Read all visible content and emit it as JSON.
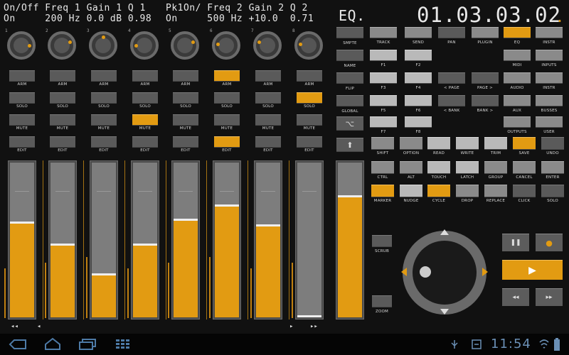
{
  "header": {
    "line1a": "On/Off Freq 1 Gain 1 Q 1",
    "line2a": "On     200 Hz 0.0 dB 0.98",
    "line1b": "Pk1On/ Freq 2 Gain 2 Q 2",
    "line2b": "On     500 Hz +10.0  0.71",
    "mode": "EQ.",
    "timecode": "01.03.03.02",
    "timecode_dot": "."
  },
  "knobs": [
    {
      "id": "1",
      "level": 0.85
    },
    {
      "id": "2",
      "level": 0.75
    },
    {
      "id": "3",
      "level": 0.5
    },
    {
      "id": "4",
      "level": 0.15
    },
    {
      "id": "5",
      "level": 0.75
    },
    {
      "id": "6",
      "level": 0.2
    },
    {
      "id": "7",
      "level": 0.25
    },
    {
      "id": "8",
      "level": 0.2
    }
  ],
  "channels": [
    {
      "arm": "ARM",
      "solo": "SOLO",
      "mute": "MUTE",
      "edit": "EDIT",
      "arm_on": false,
      "solo_on": false,
      "mute_on": false,
      "edit_on": false,
      "fader": 0.6
    },
    {
      "arm": "ARM",
      "solo": "SOLO",
      "mute": "MUTE",
      "edit": "EDIT",
      "arm_on": false,
      "solo_on": false,
      "mute_on": false,
      "edit_on": false,
      "fader": 0.46
    },
    {
      "arm": "ARM",
      "solo": "SOLO",
      "mute": "MUTE",
      "edit": "EDIT",
      "arm_on": false,
      "solo_on": false,
      "mute_on": false,
      "edit_on": false,
      "fader": 0.27
    },
    {
      "arm": "ARM",
      "solo": "SOLO",
      "mute": "MUTE",
      "edit": "EDIT",
      "arm_on": false,
      "solo_on": false,
      "mute_on": true,
      "edit_on": false,
      "fader": 0.46
    },
    {
      "arm": "ARM",
      "solo": "SOLO",
      "mute": "MUTE",
      "edit": "EDIT",
      "arm_on": false,
      "solo_on": false,
      "mute_on": false,
      "edit_on": false,
      "fader": 0.62
    },
    {
      "arm": "ARM",
      "solo": "SOLO",
      "mute": "MUTE",
      "edit": "EDIT",
      "arm_on": true,
      "solo_on": false,
      "mute_on": false,
      "edit_on": true,
      "fader": 0.71
    },
    {
      "arm": "ARM",
      "solo": "SOLO",
      "mute": "MUTE",
      "edit": "EDIT",
      "arm_on": false,
      "solo_on": false,
      "mute_on": false,
      "edit_on": false,
      "fader": 0.58
    },
    {
      "arm": "ARM",
      "solo": "SOLO",
      "mute": "MUTE",
      "edit": "EDIT",
      "arm_on": false,
      "solo_on": true,
      "mute_on": false,
      "edit_on": false,
      "fader": 0.0
    }
  ],
  "master_fader": 0.77,
  "bank_nav": {
    "left_fast": "◂◂",
    "left": "◂",
    "right": "▸",
    "right_fast": "▸▸"
  },
  "left_col": [
    {
      "label": "SMPTE",
      "on": false
    },
    {
      "label": "NAME",
      "on": false
    },
    {
      "label": "FLIP",
      "on": false
    },
    {
      "label": "GLOBAL",
      "on": false
    },
    {
      "label": "⌥",
      "on": false
    },
    {
      "label": "⬆",
      "on": false
    }
  ],
  "grid": [
    {
      "label": "TRACK",
      "style": "normal"
    },
    {
      "label": "SEND",
      "style": "normal"
    },
    {
      "label": "PAN",
      "style": "dark"
    },
    {
      "label": "PLUGIN",
      "style": "normal"
    },
    {
      "label": "EQ",
      "style": "on"
    },
    {
      "label": "INSTR",
      "style": "normal"
    },
    {
      "label": "F1",
      "style": "light"
    },
    {
      "label": "F2",
      "style": "light"
    },
    {
      "label": "",
      "style": "none"
    },
    {
      "label": "",
      "style": "none"
    },
    {
      "label": "MIDI",
      "style": "normal"
    },
    {
      "label": "INPUTS",
      "style": "normal"
    },
    {
      "label": "F3",
      "style": "light"
    },
    {
      "label": "F4",
      "style": "light"
    },
    {
      "label": "< PAGE",
      "style": "dark"
    },
    {
      "label": "PAGE >",
      "style": "dark"
    },
    {
      "label": "AUDIO",
      "style": "normal"
    },
    {
      "label": "INSTR",
      "style": "normal"
    },
    {
      "label": "F5",
      "style": "light"
    },
    {
      "label": "F6",
      "style": "light"
    },
    {
      "label": "< BANK",
      "style": "dark"
    },
    {
      "label": "BANK >",
      "style": "dark"
    },
    {
      "label": "AUX",
      "style": "normal"
    },
    {
      "label": "BUSSES",
      "style": "normal"
    },
    {
      "label": "F7",
      "style": "light"
    },
    {
      "label": "F8",
      "style": "light"
    },
    {
      "label": "",
      "style": "none"
    },
    {
      "label": "",
      "style": "none"
    },
    {
      "label": "OUTPUTS",
      "style": "normal"
    },
    {
      "label": "USER",
      "style": "normal"
    }
  ],
  "grid2": [
    {
      "label": "SHIFT",
      "style": "normal"
    },
    {
      "label": "OPTION",
      "style": "normal"
    },
    {
      "label": "READ",
      "style": "light"
    },
    {
      "label": "WRITE",
      "style": "light"
    },
    {
      "label": "TRIM",
      "style": "light"
    },
    {
      "label": "SAVE",
      "style": "on"
    },
    {
      "label": "UNDO",
      "style": "dark"
    },
    {
      "label": "CTRL",
      "style": "normal"
    },
    {
      "label": "ALT",
      "style": "normal"
    },
    {
      "label": "TOUCH",
      "style": "light"
    },
    {
      "label": "LATCH",
      "style": "light"
    },
    {
      "label": "GROUP",
      "style": "normal"
    },
    {
      "label": "CANCEL",
      "style": "normal"
    },
    {
      "label": "ENTER",
      "style": "normal"
    },
    {
      "label": "MARKER",
      "style": "on"
    },
    {
      "label": "NUDGE",
      "style": "light"
    },
    {
      "label": "CYCLE",
      "style": "on"
    },
    {
      "label": "DROP",
      "style": "normal"
    },
    {
      "label": "REPLACE",
      "style": "normal"
    },
    {
      "label": "CLICK",
      "style": "dark"
    },
    {
      "label": "SOLO",
      "style": "dark"
    }
  ],
  "scrub_label": "SCRUB",
  "zoom_label": "ZOOM",
  "transport": {
    "pause": "❚❚",
    "record": "●",
    "play": "▶",
    "rewind": "◂◂",
    "forward": "▸▸"
  },
  "statusbar": {
    "time": "11:54"
  },
  "colors": {
    "accent": "#e29b12"
  }
}
